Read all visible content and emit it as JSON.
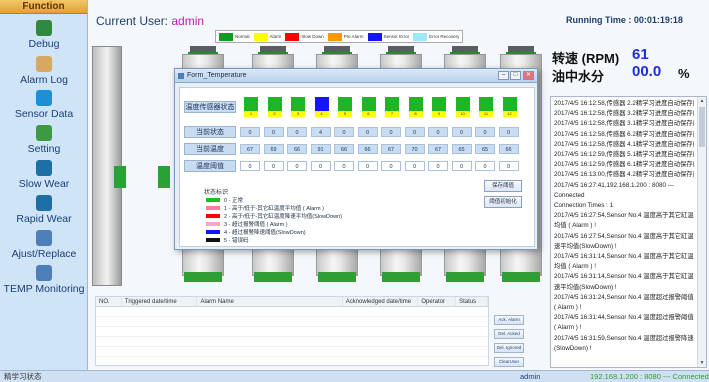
{
  "sidebar": {
    "header": "Function",
    "items": [
      {
        "label": "Debug",
        "icon": "debug-icon",
        "color": "#2f8a3f"
      },
      {
        "label": "Alarm Log",
        "icon": "alarm-log-icon",
        "color": "#d8a861"
      },
      {
        "label": "Sensor Data",
        "icon": "sensor-data-icon",
        "color": "#1d8fd8"
      },
      {
        "label": "Setting",
        "icon": "setting-icon",
        "color": "#3b9b45"
      },
      {
        "label": "Slow Wear",
        "icon": "slow-wear-icon",
        "color": "#1d6fa6"
      },
      {
        "label": "Rapid Wear",
        "icon": "rapid-wear-icon",
        "color": "#1d6fa6"
      },
      {
        "label": "Ajust/Replace",
        "icon": "adjust-replace-icon",
        "color": "#4f7fb8"
      },
      {
        "label": "TEMP Monitoring",
        "icon": "temp-monitoring-icon",
        "color": "#4f7fb8"
      }
    ]
  },
  "header": {
    "current_user_label": "Current User:",
    "current_user": "admin",
    "running_time_label": "Running Time :",
    "running_time": "00:01:19:18"
  },
  "legend": [
    {
      "label": "Normal",
      "color": "#0f9d1f"
    },
    {
      "label": "Alarm",
      "color": "#ffff00"
    },
    {
      "label": "Slow Down",
      "color": "#ff0000"
    },
    {
      "label": "Pre Alarm",
      "color": "#f59b00"
    },
    {
      "label": "Sensor Error",
      "color": "#1414ff"
    },
    {
      "label": "Error Recovery",
      "color": "#9fe6f6"
    }
  ],
  "gauges": {
    "speed_label": "转速 (RPM)",
    "speed_value": "61",
    "oil_label": "油中水分",
    "oil_value": "00.0",
    "oil_unit": "%"
  },
  "form": {
    "title": "Form_Temperature",
    "sensor_status_label": "温度传感器状态",
    "current_state_label": "当前状态",
    "current_temp_label": "当前温度",
    "threshold_label": "温度阈值",
    "sensor_numbers": [
      "1",
      "2",
      "3",
      "4",
      "5",
      "6",
      "7",
      "8",
      "9",
      "10",
      "11",
      "12"
    ],
    "sensor_colors": [
      "#1fb528",
      "#1fb528",
      "#1fb528",
      "#1414ff",
      "#1fb528",
      "#1fb528",
      "#1fb528",
      "#1fb528",
      "#1fb528",
      "#1fb528",
      "#1fb528",
      "#1fb528"
    ],
    "states": [
      "0",
      "0",
      "0",
      "4",
      "0",
      "0",
      "0",
      "0",
      "0",
      "0",
      "0",
      "0"
    ],
    "temps": [
      "67",
      "69",
      "66",
      "91",
      "66",
      "66",
      "67",
      "70",
      "67",
      "65",
      "65",
      "66"
    ],
    "thresholds": [
      "0",
      "0",
      "0",
      "0",
      "0",
      "0",
      "0",
      "0",
      "0",
      "0",
      "0",
      "0"
    ],
    "state_title": "状态标识",
    "state_legend": [
      {
        "label": "0 - 正常",
        "color": "#15c21f"
      },
      {
        "label": "1 - 高于/低于-其它缸温度平均值 ( Alarm )",
        "color": "#ff7fa0"
      },
      {
        "label": "2 - 高于/低于-其它缸温度降速平均值(SlowDown)",
        "color": "#ff0000"
      },
      {
        "label": "3 - 超过报警阈值 ( Alarm )",
        "color": "#f0a8d0"
      },
      {
        "label": "4 - 超过报警降速阈值(SlowDown)",
        "color": "#1414ff"
      },
      {
        "label": "5 - 错误码",
        "color": "#111111"
      }
    ],
    "save_button": "保存阈值",
    "init_button": "阈值初始化"
  },
  "alarm_table": {
    "columns": [
      "NO.",
      "Triggered date/time",
      "Alarm Name",
      "Acknowledged date/time",
      "Operator",
      "Status"
    ]
  },
  "action_buttons": [
    "Ack. Alarm",
    "Del. Acked",
    "Del. Ignored",
    "ClearUser"
  ],
  "log": [
    "2017/4/5 16:12:58,传感器 2.2精学习进度自动保存成功!",
    "2017/4/5 16:12:58,传感器 3.2精学习进度自动保存成功!",
    "2017/4/5 16:12:58,传感器 3.1精学习进度自动保存成功!",
    "2017/4/5 16:12:58,传感器 6.2精学习进度自动保存成功!",
    "2017/4/5 16:12:58,传感器 4.1精学习进度自动保存成功!",
    "2017/4/5 16:12:59,传感器 5.1精学习进度自动保存成功!",
    "2017/4/5 16:12:59,传感器 6.1精学习进度自动保存成功!",
    "2017/4/5 16:13:00,传感器 4.2精学习进度自动保存成功!",
    "2017/4/5 16:27:41,192.168.1.200 : 8080 ---",
    "Connected",
    "Connection Times : 1",
    "2017/4/5 16:27:54,Sensor No.4 温度高于其它缸温度平",
    "均值 ( Alarm ) !",
    "2017/4/5 16:27:54,Sensor No.4 温度高于其它缸温度降",
    "速平均值(SlowDown) !",
    "2017/4/5 16:31:14,Sensor No.4 温度高于其它缸温度平",
    "均值 ( Alarm ) !",
    "2017/4/5 16:31:14,Sensor No.4 温度高于其它缸温度降",
    "速平均值(SlowDown) !",
    "2017/4/5 16:31:24,Sensor No.4 温度超过报警阈值",
    "( Alarm ) !",
    "2017/4/5 16:31:44,Sensor No.4 温度超过报警阈值",
    "( Alarm ) !",
    "2017/4/5 16:31:59,Sensor No.4 温度超过报警降速阈值",
    "(SlowDown) !"
  ],
  "status_bar": {
    "left": "精学习状态",
    "user": "admin",
    "connection": "192.168.1.200 : 8080 --- Connected"
  }
}
